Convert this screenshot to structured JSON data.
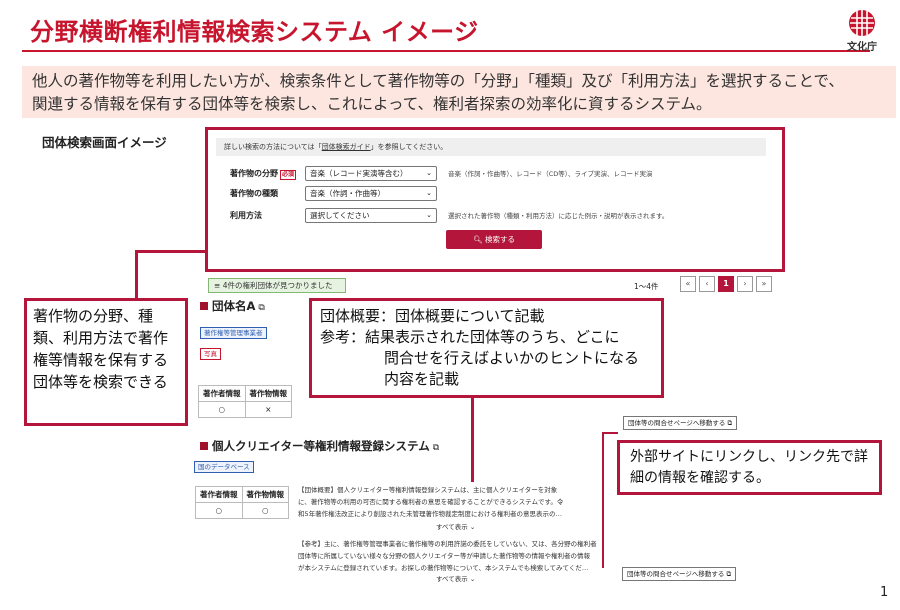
{
  "header": {
    "title": "分野横断権利情報検索システム イメージ",
    "logo_text": "文化庁"
  },
  "intro": {
    "line1": "他人の著作物等を利用したい方が、検索条件として著作物等の「分野」「種類」及び「利用方法」を選択することで、",
    "line2": "関連する情報を保有する団体等を検索し、これによって、権利者探索の効率化に資するシステム。"
  },
  "screen_label": "団体検索画面イメージ",
  "search": {
    "guide_prefix": "詳しい検索の方法については「",
    "guide_link": "団体検索ガイド",
    "guide_suffix": "」を参照してください。",
    "field_label": "著作物の分野",
    "required": "必須",
    "field_value": "音楽（レコード実演等含む）",
    "field_hint": "音楽（作詞・作曲等）、レコード（CD等）、ライブ実演、レコード実演",
    "type_label": "著作物の種類",
    "type_value": "音楽（作詞・作曲等）",
    "method_label": "利用方法",
    "method_value": "選択してください",
    "method_hint": "選択された著作物（種類・利用方法）に応じた例示・説明が表示されます。",
    "button": "検索する"
  },
  "results": {
    "count": "4件の権利団体が見つかりました",
    "range": "1〜4件",
    "pager": [
      "«",
      "‹",
      "1",
      "›",
      "»"
    ],
    "current_page": "1"
  },
  "org_a": {
    "name": "団体名A",
    "tag": "著作権等管理事業者",
    "tag2": "写真",
    "headers": [
      "著作者情報",
      "著作物情報"
    ],
    "values": [
      "○",
      "×"
    ]
  },
  "org_b": {
    "name": "個人クリエイター等権利情報登録システム",
    "tag": "国のデータベース",
    "headers": [
      "著作者情報",
      "著作物情報"
    ],
    "values": [
      "○",
      "○"
    ],
    "summary_lines": [
      "【団体概要】個人クリエイター等権利情報登録システムは、主に個人クリエイターを対象",
      "に、著作物等の利用の可否に関する権利者の意思を確認することができるシステムです。令",
      "和5年著作権法改正により創設された未管理著作物裁定制度における権利者の意思表示の…"
    ],
    "show_all": "すべて表示",
    "note_lines": [
      "【参考】主に、著作権等管理事業者に著作権等の利用許諾の委託をしていない、又は、各分野の権利者",
      "団体等に所属していない様々な分野の個人クリエイター等が申請した著作物等の情報や権利者の情報",
      "が本システムに登録されています。お探しの著作物等について、本システムでも検索してみてくだ…"
    ],
    "show_all2": "すべて表示"
  },
  "contact_link_label": "団体等の問合せページへ移動する",
  "callouts": {
    "left": "著作物の分野、種類、利用方法で著作権等情報を保有する団体等を検索できる",
    "mid_line1": "団体概要：団体概要について記載",
    "mid_line2": "参考：結果表示された団体等のうち、どこに",
    "mid_line3": "問合せを行えばよいかのヒントになる",
    "mid_line4": "内容を記載",
    "right": "外部サイトにリンクし、リンク先で詳細の情報を確認する。"
  },
  "page_number": "1"
}
